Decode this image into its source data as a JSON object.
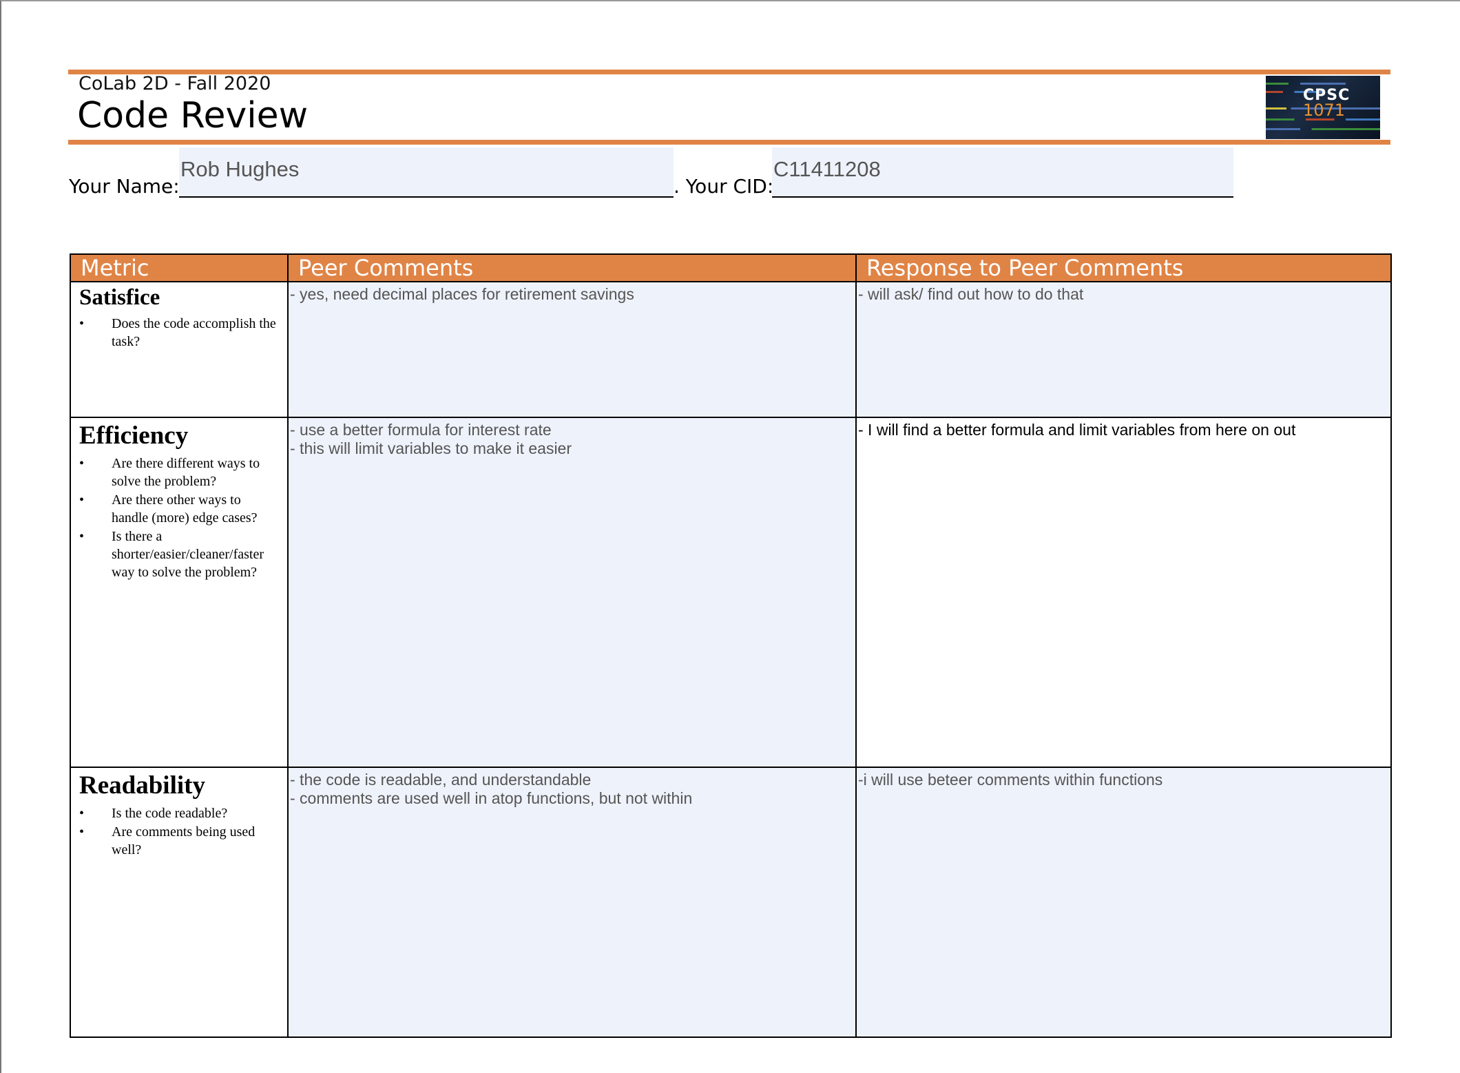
{
  "header": {
    "course": "CoLab 2D - Fall 2020",
    "title": "Code Review",
    "logo": {
      "line1": "CPSC",
      "line2": "1071"
    }
  },
  "form": {
    "name_label": "Your Name:",
    "name_value": "Rob Hughes",
    "cid_label": ". Your CID:",
    "cid_value": "C11411208"
  },
  "table": {
    "headers": [
      "Metric",
      "Peer Comments",
      "Response to Peer Comments"
    ],
    "rows": [
      {
        "metric": "Satisfice",
        "questions": [
          "Does the code accomplish the task?"
        ],
        "peer": [
          "- yes, need decimal places for retirement savings"
        ],
        "response": [
          "- will ask/ find out how to do that"
        ]
      },
      {
        "metric": "Efficiency",
        "questions": [
          "Are there different ways to solve the problem?",
          "Are there other ways to handle (more) edge cases?",
          "Is there a shorter/easier/cleaner/faster way to solve the problem?"
        ],
        "peer": [
          "- use a better formula for interest rate",
          "- this will limit variables to make it easier"
        ],
        "response": [
          "- I will find a better formula and limit variables from here on out"
        ]
      },
      {
        "metric": "Readability",
        "questions": [
          "Is the code readable?",
          "Are comments being used well?"
        ],
        "peer": [
          "- the code is readable, and understandable",
          "- comments are used well in atop functions, but not within"
        ],
        "response": [
          "-i will use beteer comments within functions"
        ]
      }
    ]
  },
  "colors": {
    "accent": "#e08446",
    "field_bg": "#eef2fb"
  }
}
